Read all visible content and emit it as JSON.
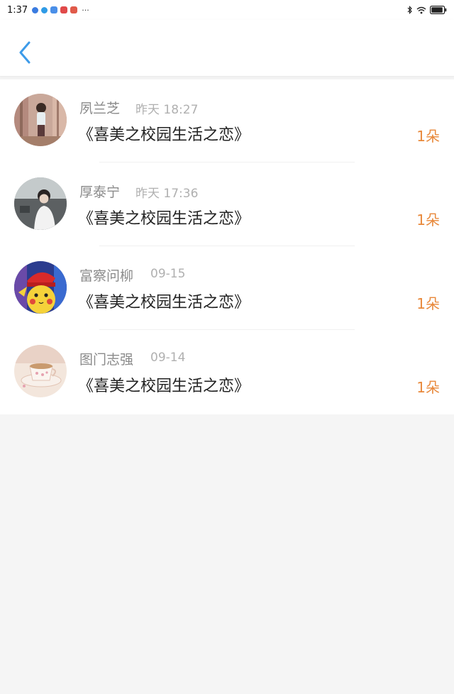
{
  "status_bar": {
    "time": "1:37",
    "more": "···",
    "app_colors": [
      "#3a7be0",
      "#2f9be6",
      "#4a7fe0",
      "#e04a4a",
      "#e05a4a"
    ]
  },
  "header": {
    "back_icon": "chevron-left-icon",
    "accent": "#3d9be9"
  },
  "list": {
    "items": [
      {
        "name": "夙兰芝",
        "time": "昨天 18:27",
        "title": "《喜美之校园生活之恋》",
        "count": "1朵",
        "avatar": "girl-in-autumn-forest"
      },
      {
        "name": "厚泰宁",
        "time": "昨天 17:36",
        "title": "《喜美之校园生活之恋》",
        "count": "1朵",
        "avatar": "boy-portrait"
      },
      {
        "name": "富察问柳",
        "time": "09-15",
        "title": "《喜美之校园生活之恋》",
        "count": "1朵",
        "avatar": "pikachu-with-red-cap"
      },
      {
        "name": "图门志强",
        "time": "09-14",
        "title": "《喜美之校园生活之恋》",
        "count": "1朵",
        "avatar": "teacup"
      }
    ]
  },
  "colors": {
    "count": "#e8883a",
    "name": "#8a8a8a",
    "time": "#b0b0b0",
    "title": "#222222"
  }
}
